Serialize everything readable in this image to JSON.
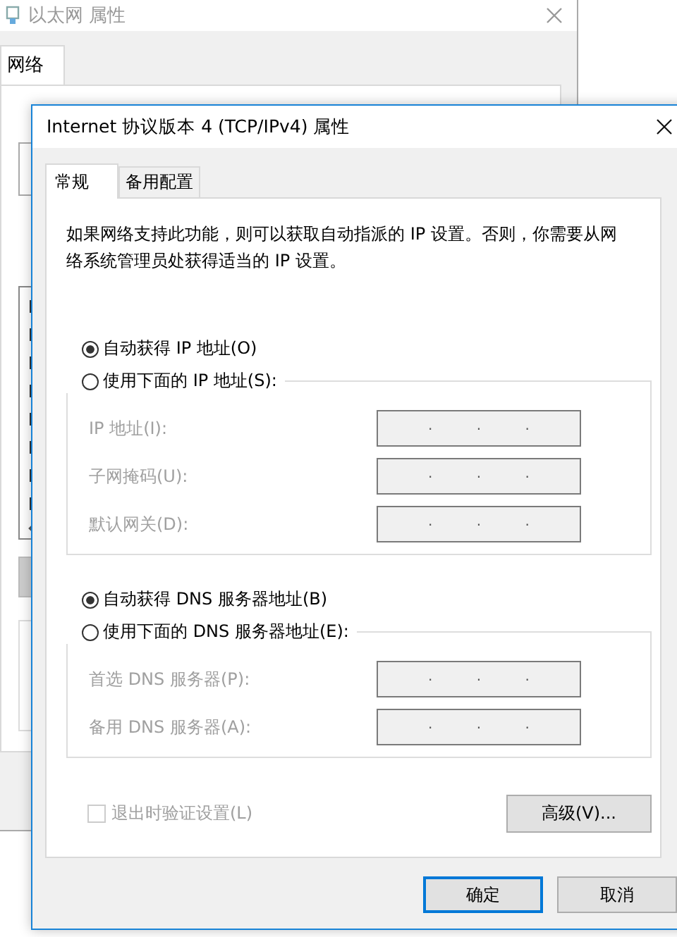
{
  "background_window": {
    "title": "以太网 属性",
    "tabs": [
      {
        "label": "网络",
        "selected": true
      }
    ]
  },
  "dialog": {
    "title": "Internet 协议版本 4 (TCP/IPv4) 属性",
    "tabs": [
      {
        "label": "常规",
        "selected": true
      },
      {
        "label": "备用配置",
        "selected": false
      }
    ],
    "description": "如果网络支持此功能，则可以获取自动指派的 IP 设置。否则，你需要从网络系统管理员处获得适当的 IP 设置。",
    "sections": [
      {
        "auto": {
          "label": "自动获得 IP 地址(O)",
          "selected": true
        },
        "manual": {
          "label": "使用下面的 IP 地址(S):",
          "selected": false
        },
        "fields": [
          {
            "label": "IP 地址(I):",
            "value": ". . .",
            "disabled": true
          },
          {
            "label": "子网掩码(U):",
            "value": ". . .",
            "disabled": true
          },
          {
            "label": "默认网关(D):",
            "value": ". . .",
            "disabled": true
          }
        ]
      },
      {
        "auto": {
          "label": "自动获得 DNS 服务器地址(B)",
          "selected": true
        },
        "manual": {
          "label": "使用下面的 DNS 服务器地址(E):",
          "selected": false
        },
        "fields": [
          {
            "label": "首选 DNS 服务器(P):",
            "value": ". . .",
            "disabled": true
          },
          {
            "label": "备用 DNS 服务器(A):",
            "value": ". . .",
            "disabled": true
          }
        ]
      }
    ],
    "validate_checkbox": {
      "label": "退出时验证设置(L)",
      "checked": false,
      "disabled": true
    },
    "advanced_button": "高级(V)...",
    "buttons": [
      {
        "label": "确定",
        "default": true
      },
      {
        "label": "取消",
        "default": false
      }
    ]
  }
}
